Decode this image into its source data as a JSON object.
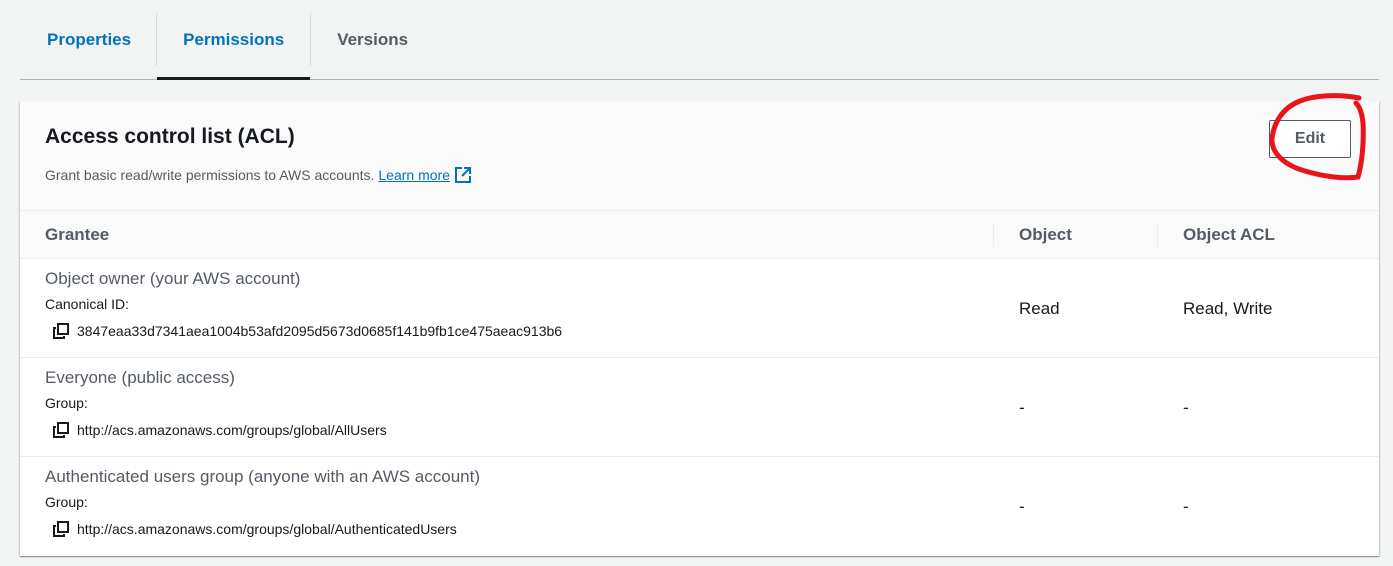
{
  "tabs": [
    {
      "label": "Properties",
      "active": false
    },
    {
      "label": "Permissions",
      "active": true
    },
    {
      "label": "Versions",
      "active": false
    }
  ],
  "acl": {
    "title": "Access control list (ACL)",
    "description": "Grant basic read/write permissions to AWS accounts.",
    "learn_more": "Learn more",
    "edit_label": "Edit",
    "columns": {
      "grantee": "Grantee",
      "object": "Object",
      "object_acl": "Object ACL"
    },
    "rows": [
      {
        "name": "Object owner (your AWS account)",
        "kind": "Canonical ID:",
        "id": "3847eaa33d7341aea1004b53afd2095d5673d0685f141b9fb1ce475aeac913b6",
        "object": "Read",
        "object_acl": "Read, Write"
      },
      {
        "name": "Everyone (public access)",
        "kind": "Group:",
        "id": "http://acs.amazonaws.com/groups/global/AllUsers",
        "object": "-",
        "object_acl": "-"
      },
      {
        "name": "Authenticated users group (anyone with an AWS account)",
        "kind": "Group:",
        "id": "http://acs.amazonaws.com/groups/global/AuthenticatedUsers",
        "object": "-",
        "object_acl": "-"
      }
    ]
  },
  "colors": {
    "link": "#0073bb",
    "annotation": "#e8141b"
  },
  "icons": {
    "external": "external-link-icon",
    "copy": "copy-icon"
  }
}
